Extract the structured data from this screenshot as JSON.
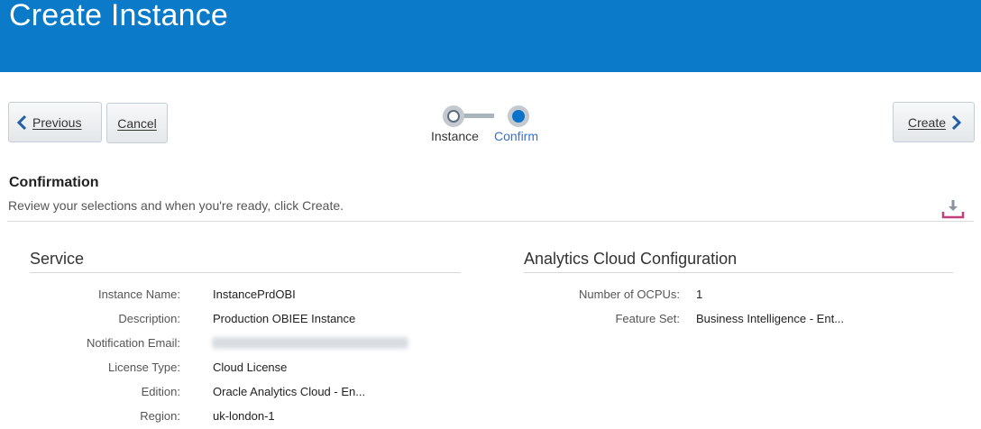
{
  "header": {
    "title": "Create Instance",
    "bg_color": "#0b7bc9"
  },
  "toolbar": {
    "previous_label": "Previous",
    "cancel_label": "Cancel",
    "create_label": "Create"
  },
  "train": {
    "steps": [
      {
        "label": "Instance",
        "state": "visited"
      },
      {
        "label": "Confirm",
        "state": "current"
      }
    ]
  },
  "confirmation": {
    "title": "Confirmation",
    "subtitle": "Review your selections and when you're ready, click Create.",
    "download_icon": "download-icon"
  },
  "service": {
    "title": "Service",
    "fields": [
      {
        "label": "Instance Name:",
        "value": "InstancePrdOBI"
      },
      {
        "label": "Description:",
        "value": "Production OBIEE Instance"
      },
      {
        "label": "Notification Email:",
        "value": ""
      },
      {
        "label": "License Type:",
        "value": "Cloud License"
      },
      {
        "label": "Edition:",
        "value": "Oracle Analytics Cloud - En..."
      },
      {
        "label": "Region:",
        "value": "uk-london-1"
      }
    ]
  },
  "analytics": {
    "title": "Analytics Cloud Configuration",
    "fields": [
      {
        "label": "Number of OCPUs:",
        "value": "1"
      },
      {
        "label": "Feature Set:",
        "value": "Business Intelligence - Ent..."
      }
    ]
  }
}
